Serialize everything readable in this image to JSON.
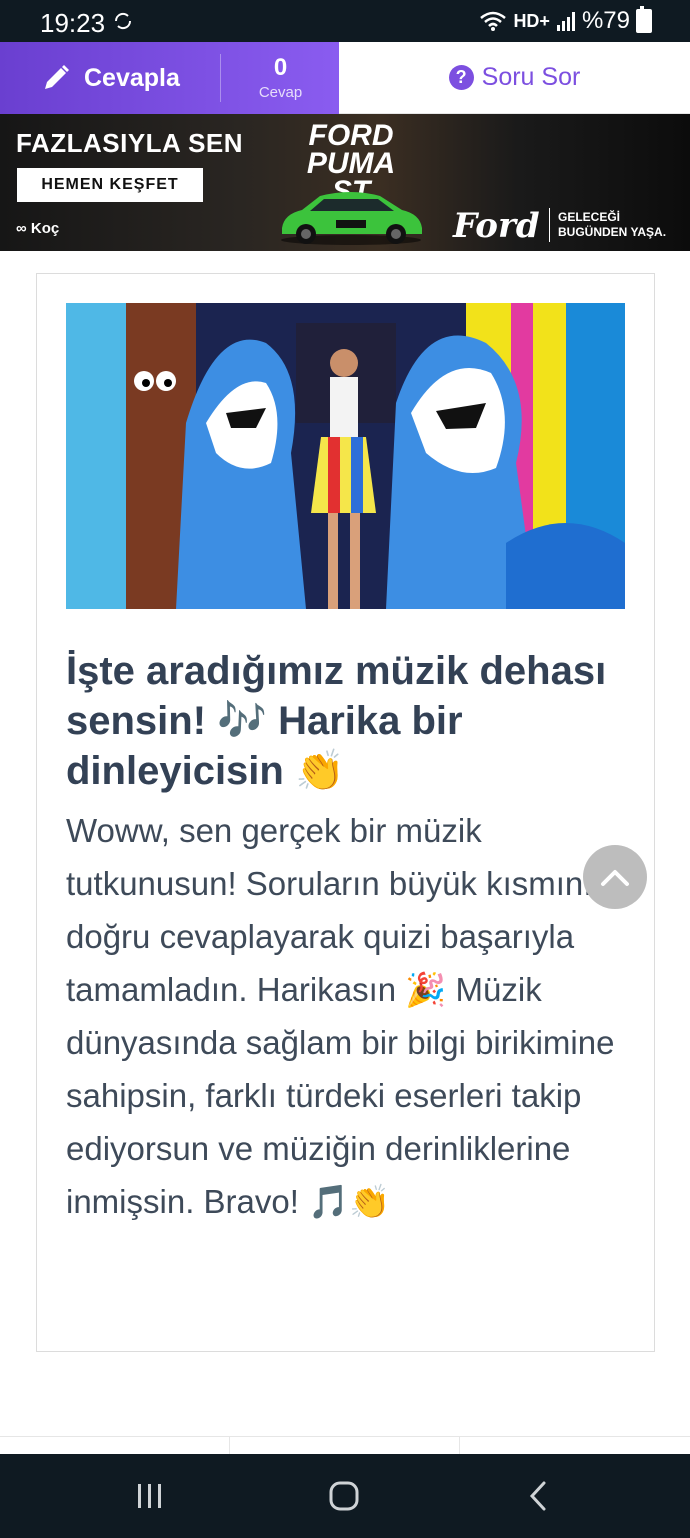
{
  "status_bar": {
    "time": "19:23",
    "network": "HD+",
    "battery": "%79",
    "icons": [
      "sync-icon",
      "wifi-icon",
      "signal-icon",
      "battery-icon"
    ]
  },
  "action_bar": {
    "answer_label": "Cevapla",
    "answer_count": "0",
    "answer_count_caption": "Cevap",
    "ask_label": "Soru Sor",
    "colors": {
      "accent": "#7c4fe0"
    }
  },
  "ad": {
    "headline": "FAZLASIYLA SEN",
    "cta": "HEMEN KEŞFET",
    "model": "FORD PUMA ST",
    "brand": "Ford",
    "slogan_line1": "GELECEĞİ",
    "slogan_line2": "BUGÜNDEN YAŞA.",
    "sponsor": "Koç"
  },
  "result": {
    "title": "İşte aradığımız müzik dehası sensin! 🎶 Harika bir dinleyicisin 👏",
    "description": "Woww, sen gerçek bir müzik tutkunusun! Soruların büyük kısmını doğru cevaplayarak quizi başarıyla tamamladın. Harikasın 🎉 Müzik dünyasında sağlam bir bilgi birikimine sahipsin, farklı türdeki eserleri takip ediyorsun ve müziğin derinliklerine inmişsin. Bravo! 🎵👏"
  },
  "nav": {
    "icons": [
      "recent-apps-icon",
      "home-icon",
      "back-icon"
    ]
  }
}
